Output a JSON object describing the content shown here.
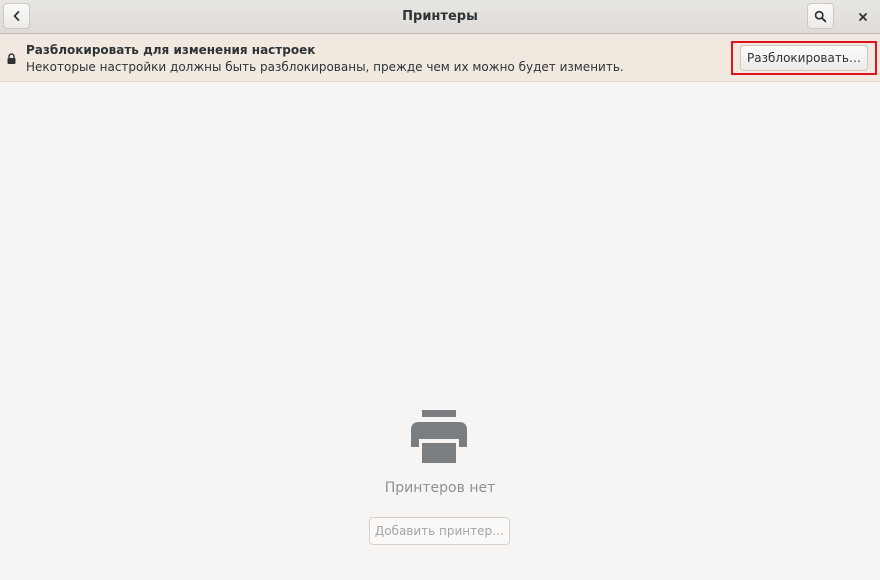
{
  "window": {
    "title": "Принтеры"
  },
  "headerbar": {
    "back_icon": "chevron-left-icon",
    "search_icon": "search-icon",
    "close_icon": "close-icon"
  },
  "infobar": {
    "icon": "lock-icon",
    "title": "Разблокировать для изменения настроек",
    "subtitle": "Некоторые настройки должны быть разблокированы, прежде чем их можно будет изменить.",
    "unlock_label": "Разблокировать…",
    "highlight_color": "#e0141e"
  },
  "empty_state": {
    "icon": "printer-icon",
    "label": "Принтеров нет",
    "add_button_label": "Добавить принтер…"
  }
}
